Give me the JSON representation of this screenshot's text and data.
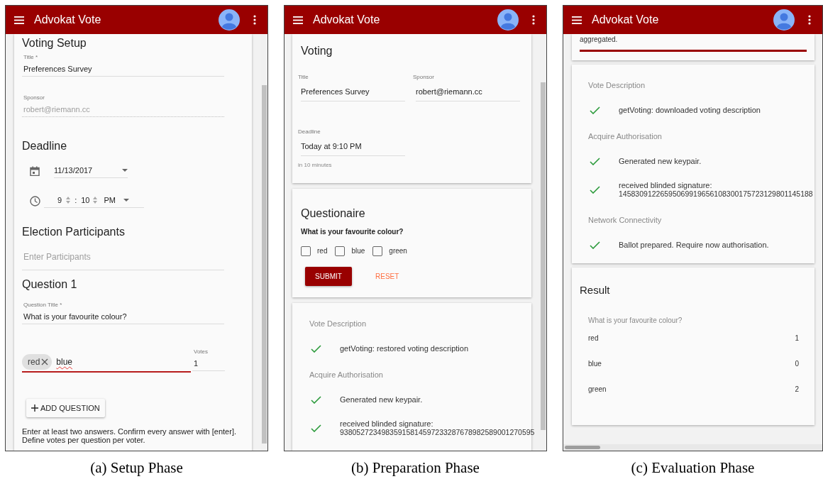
{
  "setup_phase": {
    "caption": "(a) Setup Phase",
    "app_title": "Advokat Vote",
    "heading": "Voting Setup",
    "title_field": {
      "label": "Title *",
      "value": "Preferences Survey"
    },
    "sponsor_field": {
      "label": "Sponsor",
      "value": "robert@riemann.cc",
      "disabled": true
    },
    "deadline_heading": "Deadline",
    "date": "11/13/2017",
    "time": {
      "hour": "9",
      "separator": ":",
      "minute": "10",
      "period": "PM"
    },
    "participants_heading": "Election Participants",
    "participants_field": {
      "placeholder": "Enter Participants"
    },
    "question_heading": "Question 1",
    "question_title_field": {
      "label": "Question Title *",
      "value": "What is your favourite colour?"
    },
    "answers_field": {
      "chips": [
        "red"
      ],
      "value": "blue",
      "focused": true
    },
    "votes_field": {
      "label": "Votes",
      "value": "1"
    },
    "add_question_button": "ADD QUESTION",
    "help_text": "Enter at least two answers. Confirm every answer with [enter]. Define votes per question per voter."
  },
  "preparation_phase": {
    "caption": "(b) Preparation Phase",
    "app_title": "Advokat Vote",
    "voting_card": {
      "heading": "Voting",
      "fields": [
        {
          "label": "Title",
          "value": "Preferences Survey"
        },
        {
          "label": "Sponsor",
          "value": "robert@riemann.cc"
        }
      ],
      "deadline": {
        "label": "Deadline",
        "value": "Today at 9:10 PM",
        "hint": "in 10 minutes"
      }
    },
    "questionnaire_card": {
      "heading": "Questionaire",
      "question": "What is your favourite colour?",
      "options": [
        {
          "label": "red",
          "checked": false
        },
        {
          "label": "blue",
          "checked": false
        },
        {
          "label": "green",
          "checked": false
        }
      ],
      "buttons": [
        {
          "label": "SUBMIT",
          "kind": "raised"
        },
        {
          "label": "RESET",
          "kind": "flat"
        }
      ]
    },
    "status_card": {
      "groups": [
        {
          "heading": "Vote Description",
          "items": [
            {
              "text": "getVoting: restored voting description",
              "done": true
            }
          ]
        },
        {
          "heading": "Acquire Authorisation",
          "items": [
            {
              "text": "Generated new keypair.",
              "done": true
            },
            {
              "text": "received blinded signature:",
              "detail": "93805272349835915814597233287678982589001270595",
              "done": true
            }
          ]
        }
      ]
    }
  },
  "evaluation_phase": {
    "caption": "(c) Evaluation Phase",
    "app_title": "Advokat Vote",
    "progress_card": {
      "text": "aggregated.",
      "level": 1
    },
    "status_card": {
      "groups": [
        {
          "heading": "Vote Description",
          "items": [
            {
              "text": "getVoting: downloaded voting description",
              "done": true
            }
          ]
        },
        {
          "heading": "Acquire Authorisation",
          "items": [
            {
              "text": "Generated new keypair.",
              "done": true
            },
            {
              "text": "received blinded signature:",
              "detail": "14583091226595069919656108300175723129801145188",
              "done": true
            }
          ]
        },
        {
          "heading": "Network Connectivity",
          "items": [
            {
              "text": "Ballot prepared. Require now authorisation.",
              "done": true
            }
          ]
        }
      ]
    },
    "result_card": {
      "heading": "Result",
      "question": "What is your favourite colour?",
      "rows": [
        {
          "answer": "red",
          "votes": "1"
        },
        {
          "answer": "blue",
          "votes": "0"
        },
        {
          "answer": "green",
          "votes": "2"
        }
      ]
    }
  }
}
